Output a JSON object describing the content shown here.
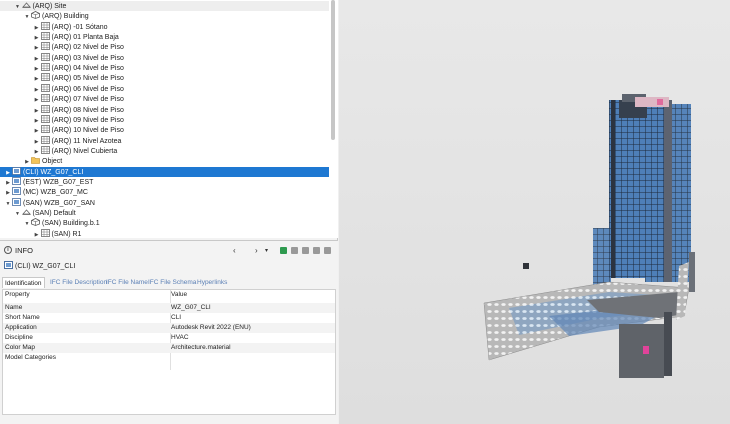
{
  "tree": {
    "items": [
      {
        "label": "(ARQ) Site",
        "toggle": "▼",
        "icon": "site-icon",
        "level": 1
      },
      {
        "label": "(ARQ) Building",
        "toggle": "▼",
        "icon": "building-icon",
        "level": 2
      },
      {
        "label": "(ARQ) -01 Sótano",
        "toggle": "▶",
        "icon": "storey-icon",
        "level": 3
      },
      {
        "label": "(ARQ) 01 Planta Baja",
        "toggle": "▶",
        "icon": "storey-icon",
        "level": 3
      },
      {
        "label": "(ARQ) 02 Nivel de Piso",
        "toggle": "▶",
        "icon": "storey-icon",
        "level": 3
      },
      {
        "label": "(ARQ) 03 Nivel de Piso",
        "toggle": "▶",
        "icon": "storey-icon",
        "level": 3
      },
      {
        "label": "(ARQ) 04 Nivel de Piso",
        "toggle": "▶",
        "icon": "storey-icon",
        "level": 3
      },
      {
        "label": "(ARQ) 05 Nivel de Piso",
        "toggle": "▶",
        "icon": "storey-icon",
        "level": 3
      },
      {
        "label": "(ARQ) 06 Nivel de Piso",
        "toggle": "▶",
        "icon": "storey-icon",
        "level": 3
      },
      {
        "label": "(ARQ) 07 Nivel de Piso",
        "toggle": "▶",
        "icon": "storey-icon",
        "level": 3
      },
      {
        "label": "(ARQ) 08 Nivel de Piso",
        "toggle": "▶",
        "icon": "storey-icon",
        "level": 3
      },
      {
        "label": "(ARQ) 09 Nivel de Piso",
        "toggle": "▶",
        "icon": "storey-icon",
        "level": 3
      },
      {
        "label": "(ARQ) 10 Nivel de Piso",
        "toggle": "▶",
        "icon": "storey-icon",
        "level": 3
      },
      {
        "label": "(ARQ) 11 Nivel Azotea",
        "toggle": "▶",
        "icon": "storey-icon",
        "level": 3
      },
      {
        "label": "(ARQ) Nivel Cubierta",
        "toggle": "▶",
        "icon": "storey-icon",
        "level": 3
      },
      {
        "label": "Object",
        "toggle": "▶",
        "icon": "folder-icon",
        "level": 2
      },
      {
        "label": "(CLI) WZ_G07_CLI",
        "toggle": "▶",
        "icon": "model-icon",
        "level": 0,
        "selected": true
      },
      {
        "label": "(EST) WZB_G07_EST",
        "toggle": "▶",
        "icon": "model-icon",
        "level": 0
      },
      {
        "label": "(MC) WZB_G07_MC",
        "toggle": "▶",
        "icon": "model-icon",
        "level": 0
      },
      {
        "label": "(SAN) WZB_G07_SAN",
        "toggle": "▼",
        "icon": "model-icon",
        "level": 0
      },
      {
        "label": "(SAN) Default",
        "toggle": "▼",
        "icon": "site-icon",
        "level": 1
      },
      {
        "label": "(SAN) Building.b.1",
        "toggle": "▼",
        "icon": "building-icon",
        "level": 2
      },
      {
        "label": "(SAN) R1",
        "toggle": "▶",
        "icon": "storey-icon",
        "level": 3
      }
    ]
  },
  "info": {
    "title": "INFO",
    "selected_label": "(CLI) WZ_G07_CLI",
    "tabs": [
      "Identification",
      "IFC File Description",
      "IFC File Name",
      "IFC File Schema",
      "Hyperlinks"
    ],
    "columns": [
      "Property",
      "Value"
    ],
    "rows": [
      {
        "k": "Name",
        "v": "WZ_G07_CLI"
      },
      {
        "k": "Short Name",
        "v": "CLI"
      },
      {
        "k": "Application",
        "v": "Autodesk Revit 2022 (ENU)"
      },
      {
        "k": "Discipline",
        "v": "HVAC"
      },
      {
        "k": "Color Map",
        "v": "Architecture.material"
      },
      {
        "k": "Model Categories",
        "v": ""
      }
    ],
    "nav": {
      "back": "‹",
      "fwd": "›",
      "menu": "▾"
    }
  },
  "colors": {
    "selection": "#1e78d2",
    "tab_link": "#5a7fb5",
    "facade": "#3d6ea8"
  }
}
